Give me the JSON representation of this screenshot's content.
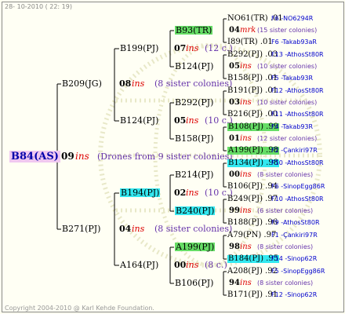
{
  "header": {
    "date_line": "28- 10-2010 ( 22: 19)"
  },
  "footer": {
    "copyright": "Copyright 2004-2010 @ Karl Kehde Foundation."
  },
  "root": {
    "name": "B84(AS)",
    "gen": "09",
    "ins": "ins",
    "note": "(Drones from 9 sister colonies)"
  },
  "level1": [
    {
      "name": "B209(JG)",
      "gen": "08",
      "ins": "ins",
      "note": "(8 sister colonies)"
    },
    {
      "name": "B271(PJ)",
      "gen": "04",
      "ins": "ins",
      "note": "(8 sister colonies)"
    }
  ],
  "level2": [
    {
      "name": "B199(PJ)",
      "gen": "07",
      "ins": "ins",
      "note": "(12 c.)"
    },
    {
      "name": "B124(PJ)",
      "gen": "05",
      "ins": "ins",
      "note": "(10 c.)"
    },
    {
      "name": "B194(PJ)",
      "gen": "02",
      "ins": "ins",
      "note": "(10 c.)"
    },
    {
      "name": "A164(PJ)",
      "gen": "00",
      "ins": "ins",
      "note": "(8 c.)"
    }
  ],
  "level3": [
    {
      "name": "B93(TR)"
    },
    {
      "name": "B124(PJ)"
    },
    {
      "name": "B292(PJ)"
    },
    {
      "name": "B158(PJ)"
    },
    {
      "name": "B214(PJ)"
    },
    {
      "name": "B240(PJ)"
    },
    {
      "name": "A199(PJ)"
    },
    {
      "name": "B106(PJ)"
    }
  ],
  "leaves": [
    {
      "top": "NO61(TR) .01",
      "top_r": "F6 -NO6294R",
      "gen": "04",
      "ins": "mrk",
      "note": "(15 sister colonies)",
      "bot": "I89(TR) .01",
      "bot_r": "F6 -Takab93aR"
    },
    {
      "top": "B292(PJ) .03",
      "top_r": "F13 -AthosSt80R",
      "gen": "05",
      "ins": "ins",
      "note": "(10 sister colonies)",
      "bot": "B158(PJ) .01",
      "bot_r": "F5 -Takab93R"
    },
    {
      "top": "B191(PJ) .01",
      "top_r": "F12 -AthosSt80R",
      "gen": "03",
      "ins": "ins",
      "note": "(10 sister colonies)",
      "bot": "B216(PJ) .00",
      "bot_r": "F11 -AthosSt80R"
    },
    {
      "top": "B108(PJ) .99",
      "top_r": "F4 -Takab93R",
      "gen": "01",
      "ins": "ins",
      "note": "(12 sister colonies)",
      "bot": "A199(PJ) .98",
      "bot_r": "F2 -Çankiri97R"
    },
    {
      "top": "B134(PJ) .98",
      "top_r": "F10 -AthosSt80R",
      "gen": "00",
      "ins": "ins",
      "note": "(8 sister colonies)",
      "bot": "B106(PJ) .94",
      "bot_r": "F6 -SinopEgg86R"
    },
    {
      "top": "B249(PJ) .97",
      "top_r": "F10 -AthosSt80R",
      "gen": "99",
      "ins": "ins",
      "note": "(6 sister colonies)",
      "bot": "B188(PJ) .96",
      "bot_r": "F9 -AthosSt80R"
    },
    {
      "top": "A79(PN) .97",
      "top_r": "F1 -Çankiri97R",
      "gen": "98",
      "ins": "ins",
      "note": "(8 sister colonies)",
      "bot": "B184(PJ) .95",
      "bot_r": "F14 -Sinop62R"
    },
    {
      "top": "A208(PJ) .92",
      "top_r": "F5 -SinopEgg86R",
      "gen": "94",
      "ins": "ins",
      "note": "(8 sister colonies)",
      "bot": "B171(PJ) .91",
      "bot_r": "F12 -Sinop62R"
    }
  ]
}
